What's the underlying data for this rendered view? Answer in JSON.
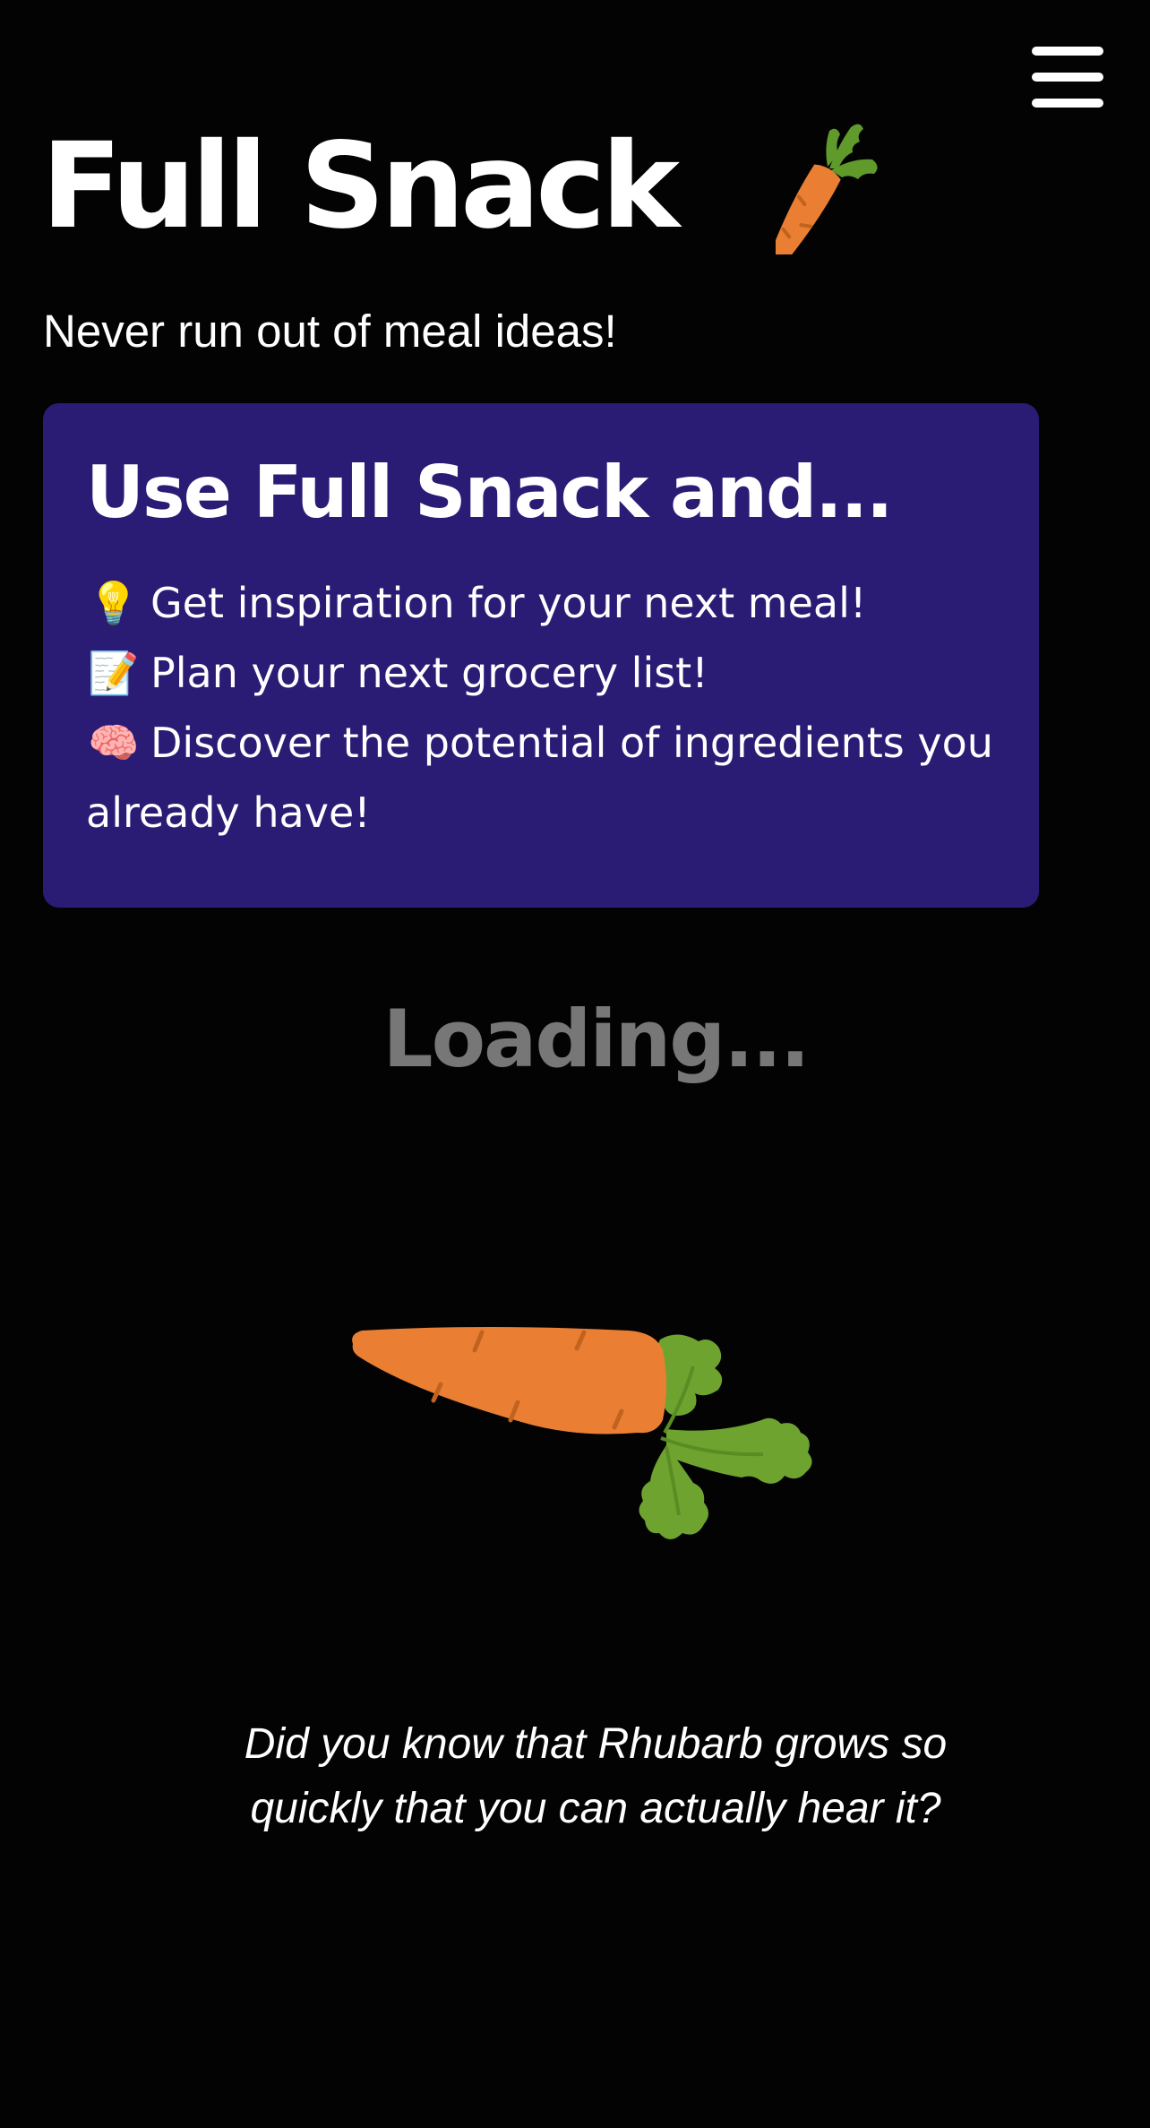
{
  "header": {
    "menu_icon": "hamburger-menu-icon",
    "title": "Full Snack",
    "title_emoji": "carrot-icon",
    "tagline": "Never run out of meal ideas!"
  },
  "card": {
    "heading": "Use Full Snack and...",
    "background_color": "#2a1b75",
    "features": [
      {
        "emoji": "💡",
        "icon": "lightbulb-icon",
        "text": "Get inspiration for your next meal!"
      },
      {
        "emoji": "📝",
        "icon": "memo-icon",
        "text": "Plan your next grocery list!"
      },
      {
        "emoji": "🧠",
        "icon": "brain-icon",
        "text": "Discover the potential of ingredients you already have!"
      }
    ]
  },
  "loading": {
    "text": "Loading...",
    "illustration": "carrot-icon",
    "fun_fact": "Did you know that Rhubarb grows so quickly that you can actually hear it?"
  },
  "colors": {
    "background": "#040304",
    "carrot_orange": "#ea7f33",
    "leaf_green": "#6fa32f",
    "loading_text": "#777777"
  }
}
